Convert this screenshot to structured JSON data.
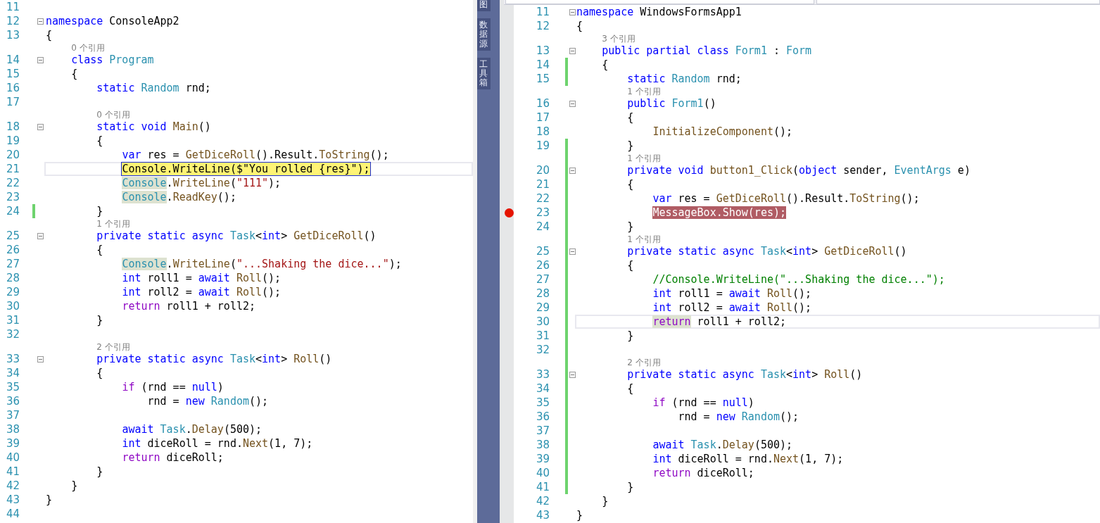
{
  "left_editor": {
    "lines": [
      {
        "number": "11"
      },
      {
        "number": "12",
        "fold": true,
        "tokens": [
          {
            "kind": "keyword",
            "text": "namespace"
          },
          {
            "kind": "plain",
            "text": " ConsoleApp2"
          }
        ]
      },
      {
        "number": "13",
        "tokens": [
          {
            "kind": "plain",
            "text": "{"
          }
        ]
      },
      {
        "lens": true,
        "text": "    0 个引用"
      },
      {
        "number": "14",
        "fold": true,
        "tokens": [
          {
            "kind": "keyword",
            "text": "    class "
          },
          {
            "kind": "type",
            "text": "Program"
          }
        ]
      },
      {
        "number": "15",
        "tokens": [
          {
            "kind": "plain",
            "text": "    {"
          }
        ]
      },
      {
        "number": "16",
        "tokens": [
          {
            "kind": "keyword",
            "text": "        static "
          },
          {
            "kind": "type",
            "text": "Random"
          },
          {
            "kind": "plain",
            "text": " rnd;"
          }
        ]
      },
      {
        "number": "17"
      },
      {
        "lens": true,
        "text": "        0 个引用"
      },
      {
        "number": "18",
        "fold": true,
        "tokens": [
          {
            "kind": "keyword",
            "text": "        static void "
          },
          {
            "kind": "method",
            "text": "Main"
          },
          {
            "kind": "plain",
            "text": "()"
          }
        ]
      },
      {
        "number": "19",
        "tokens": [
          {
            "kind": "plain",
            "text": "        {"
          }
        ]
      },
      {
        "number": "20",
        "tokens": [
          {
            "kind": "keyword",
            "text": "            var"
          },
          {
            "kind": "plain",
            "text": " res = "
          },
          {
            "kind": "method",
            "text": "GetDiceRoll"
          },
          {
            "kind": "plain",
            "text": "().Result."
          },
          {
            "kind": "method",
            "text": "ToString"
          },
          {
            "kind": "plain",
            "text": "();"
          }
        ]
      },
      {
        "number": "21",
        "caret": true,
        "current_statement": true,
        "tokens": [
          {
            "kind": "plain",
            "text": "            Console.WriteLine($\"You rolled {res}\");"
          }
        ]
      },
      {
        "number": "22",
        "tokens": [
          {
            "kind": "type",
            "text": "            Console",
            "highlighted": true
          },
          {
            "kind": "plain",
            "text": "."
          },
          {
            "kind": "method",
            "text": "WriteLine"
          },
          {
            "kind": "plain",
            "text": "("
          },
          {
            "kind": "string",
            "text": "\"111\""
          },
          {
            "kind": "plain",
            "text": ");"
          }
        ]
      },
      {
        "number": "23",
        "tokens": [
          {
            "kind": "type",
            "text": "            Console",
            "highlighted": true
          },
          {
            "kind": "plain",
            "text": "."
          },
          {
            "kind": "method",
            "text": "ReadKey"
          },
          {
            "kind": "plain",
            "text": "();"
          }
        ]
      },
      {
        "number": "24",
        "changed": true,
        "tokens": [
          {
            "kind": "plain",
            "text": "        }"
          }
        ]
      },
      {
        "lens": true,
        "text": "        1 个引用"
      },
      {
        "number": "25",
        "fold": true,
        "tokens": [
          {
            "kind": "keyword",
            "text": "        private static async "
          },
          {
            "kind": "type",
            "text": "Task"
          },
          {
            "kind": "plain",
            "text": "<"
          },
          {
            "kind": "keyword",
            "text": "int"
          },
          {
            "kind": "plain",
            "text": "> "
          },
          {
            "kind": "method",
            "text": "GetDiceRoll"
          },
          {
            "kind": "plain",
            "text": "()"
          }
        ]
      },
      {
        "number": "26",
        "tokens": [
          {
            "kind": "plain",
            "text": "        {"
          }
        ]
      },
      {
        "number": "27",
        "tokens": [
          {
            "kind": "type",
            "text": "            Console",
            "highlighted": true
          },
          {
            "kind": "plain",
            "text": "."
          },
          {
            "kind": "method",
            "text": "WriteLine"
          },
          {
            "kind": "plain",
            "text": "("
          },
          {
            "kind": "string",
            "text": "\"...Shaking the dice...\""
          },
          {
            "kind": "plain",
            "text": ");"
          }
        ]
      },
      {
        "number": "28",
        "tokens": [
          {
            "kind": "keyword",
            "text": "            int"
          },
          {
            "kind": "plain",
            "text": " roll1 = "
          },
          {
            "kind": "keyword",
            "text": "await "
          },
          {
            "kind": "method",
            "text": "Roll"
          },
          {
            "kind": "plain",
            "text": "();"
          }
        ]
      },
      {
        "number": "29",
        "tokens": [
          {
            "kind": "keyword",
            "text": "            int"
          },
          {
            "kind": "plain",
            "text": " roll2 = "
          },
          {
            "kind": "keyword",
            "text": "await "
          },
          {
            "kind": "method",
            "text": "Roll"
          },
          {
            "kind": "plain",
            "text": "();"
          }
        ]
      },
      {
        "number": "30",
        "tokens": [
          {
            "kind": "control",
            "text": "            return"
          },
          {
            "kind": "plain",
            "text": " roll1 + roll2;"
          }
        ]
      },
      {
        "number": "31",
        "tokens": [
          {
            "kind": "plain",
            "text": "        }"
          }
        ]
      },
      {
        "number": "32"
      },
      {
        "lens": true,
        "text": "        2 个引用"
      },
      {
        "number": "33",
        "fold": true,
        "tokens": [
          {
            "kind": "keyword",
            "text": "        private static async "
          },
          {
            "kind": "type",
            "text": "Task"
          },
          {
            "kind": "plain",
            "text": "<"
          },
          {
            "kind": "keyword",
            "text": "int"
          },
          {
            "kind": "plain",
            "text": "> "
          },
          {
            "kind": "method",
            "text": "Roll"
          },
          {
            "kind": "plain",
            "text": "()"
          }
        ]
      },
      {
        "number": "34",
        "tokens": [
          {
            "kind": "plain",
            "text": "        {"
          }
        ]
      },
      {
        "number": "35",
        "tokens": [
          {
            "kind": "control",
            "text": "            if"
          },
          {
            "kind": "plain",
            "text": " (rnd == "
          },
          {
            "kind": "keyword",
            "text": "null"
          },
          {
            "kind": "plain",
            "text": ")"
          }
        ]
      },
      {
        "number": "36",
        "tokens": [
          {
            "kind": "plain",
            "text": "                rnd = "
          },
          {
            "kind": "keyword",
            "text": "new "
          },
          {
            "kind": "type",
            "text": "Random"
          },
          {
            "kind": "plain",
            "text": "();"
          }
        ]
      },
      {
        "number": "37"
      },
      {
        "number": "38",
        "tokens": [
          {
            "kind": "keyword",
            "text": "            await "
          },
          {
            "kind": "type",
            "text": "Task"
          },
          {
            "kind": "plain",
            "text": "."
          },
          {
            "kind": "method",
            "text": "Delay"
          },
          {
            "kind": "plain",
            "text": "(500);"
          }
        ]
      },
      {
        "number": "39",
        "tokens": [
          {
            "kind": "keyword",
            "text": "            int"
          },
          {
            "kind": "plain",
            "text": " diceRoll = rnd."
          },
          {
            "kind": "method",
            "text": "Next"
          },
          {
            "kind": "plain",
            "text": "(1, 7);"
          }
        ]
      },
      {
        "number": "40",
        "tokens": [
          {
            "kind": "control",
            "text": "            return"
          },
          {
            "kind": "plain",
            "text": " diceRoll;"
          }
        ]
      },
      {
        "number": "41",
        "tokens": [
          {
            "kind": "plain",
            "text": "        }"
          }
        ]
      },
      {
        "number": "42",
        "tokens": [
          {
            "kind": "plain",
            "text": "    }"
          }
        ]
      },
      {
        "number": "43",
        "tokens": [
          {
            "kind": "plain",
            "text": "}"
          }
        ]
      },
      {
        "number": "44"
      }
    ]
  },
  "side_tabs": [
    {
      "label": "图"
    },
    {
      "label": "数据源"
    },
    {
      "label": "工具箱"
    }
  ],
  "right_editor": {
    "lines": [
      {
        "number": "11",
        "fold": true,
        "tokens": [
          {
            "kind": "keyword",
            "text": "namespace"
          },
          {
            "kind": "plain",
            "text": " WindowsFormsApp1"
          }
        ]
      },
      {
        "number": "12",
        "tokens": [
          {
            "kind": "plain",
            "text": "{"
          }
        ]
      },
      {
        "lens": true,
        "text": "    3 个引用"
      },
      {
        "number": "13",
        "fold": true,
        "tokens": [
          {
            "kind": "keyword",
            "text": "    public partial class "
          },
          {
            "kind": "type",
            "text": "Form1"
          },
          {
            "kind": "plain",
            "text": " : "
          },
          {
            "kind": "type",
            "text": "Form"
          }
        ]
      },
      {
        "number": "14",
        "changed": true,
        "tokens": [
          {
            "kind": "plain",
            "text": "    {"
          }
        ]
      },
      {
        "number": "15",
        "changed": true,
        "tokens": [
          {
            "kind": "keyword",
            "text": "        static "
          },
          {
            "kind": "type",
            "text": "Random"
          },
          {
            "kind": "plain",
            "text": " rnd;"
          }
        ]
      },
      {
        "lens": true,
        "text": "        1 个引用"
      },
      {
        "number": "16",
        "fold": true,
        "tokens": [
          {
            "kind": "keyword",
            "text": "        public "
          },
          {
            "kind": "type",
            "text": "Form1"
          },
          {
            "kind": "plain",
            "text": "()"
          }
        ]
      },
      {
        "number": "17",
        "tokens": [
          {
            "kind": "plain",
            "text": "        {"
          }
        ]
      },
      {
        "number": "18",
        "tokens": [
          {
            "kind": "method",
            "text": "            InitializeComponent"
          },
          {
            "kind": "plain",
            "text": "();"
          }
        ]
      },
      {
        "number": "19",
        "changed": true,
        "tokens": [
          {
            "kind": "plain",
            "text": "        }"
          }
        ]
      },
      {
        "lens": true,
        "changed": true,
        "text": "        1 个引用"
      },
      {
        "number": "20",
        "fold": true,
        "changed": true,
        "tokens": [
          {
            "kind": "keyword",
            "text": "        private void "
          },
          {
            "kind": "method",
            "text": "button1_Click"
          },
          {
            "kind": "plain",
            "text": "("
          },
          {
            "kind": "keyword",
            "text": "object"
          },
          {
            "kind": "plain",
            "text": " sender, "
          },
          {
            "kind": "type",
            "text": "EventArgs"
          },
          {
            "kind": "plain",
            "text": " e)"
          }
        ]
      },
      {
        "number": "21",
        "changed": true,
        "tokens": [
          {
            "kind": "plain",
            "text": "        {"
          }
        ]
      },
      {
        "number": "22",
        "changed": true,
        "tokens": [
          {
            "kind": "keyword",
            "text": "            var"
          },
          {
            "kind": "plain",
            "text": " res = "
          },
          {
            "kind": "method",
            "text": "GetDiceRoll"
          },
          {
            "kind": "plain",
            "text": "().Result."
          },
          {
            "kind": "method",
            "text": "ToString"
          },
          {
            "kind": "plain",
            "text": "();"
          }
        ]
      },
      {
        "number": "23",
        "changed": true,
        "breakpoint": true,
        "tokens": [
          {
            "kind": "plain",
            "text": "            MessageBox.Show(res);"
          }
        ]
      },
      {
        "number": "24",
        "changed": true,
        "tokens": [
          {
            "kind": "plain",
            "text": "        }"
          }
        ]
      },
      {
        "lens": true,
        "changed": true,
        "text": "        1 个引用"
      },
      {
        "number": "25",
        "fold": true,
        "changed": true,
        "tokens": [
          {
            "kind": "keyword",
            "text": "        private static async "
          },
          {
            "kind": "type",
            "text": "Task"
          },
          {
            "kind": "plain",
            "text": "<"
          },
          {
            "kind": "keyword",
            "text": "int"
          },
          {
            "kind": "plain",
            "text": "> "
          },
          {
            "kind": "method",
            "text": "GetDiceRoll"
          },
          {
            "kind": "plain",
            "text": "()"
          }
        ]
      },
      {
        "number": "26",
        "changed": true,
        "tokens": [
          {
            "kind": "plain",
            "text": "        {"
          }
        ]
      },
      {
        "number": "27",
        "changed": true,
        "tokens": [
          {
            "kind": "comment",
            "text": "            //Console.WriteLine(\"...Shaking the dice...\");"
          }
        ]
      },
      {
        "number": "28",
        "changed": true,
        "tokens": [
          {
            "kind": "keyword",
            "text": "            int"
          },
          {
            "kind": "plain",
            "text": " roll1 = "
          },
          {
            "kind": "keyword",
            "text": "await "
          },
          {
            "kind": "method",
            "text": "Roll"
          },
          {
            "kind": "plain",
            "text": "();"
          }
        ]
      },
      {
        "number": "29",
        "changed": true,
        "tokens": [
          {
            "kind": "keyword",
            "text": "            int"
          },
          {
            "kind": "plain",
            "text": " roll2 = "
          },
          {
            "kind": "keyword",
            "text": "await "
          },
          {
            "kind": "method",
            "text": "Roll"
          },
          {
            "kind": "plain",
            "text": "();"
          }
        ]
      },
      {
        "number": "30",
        "changed": true,
        "caret": true,
        "tokens": [
          {
            "kind": "control",
            "text": "            return",
            "highlighted": true
          },
          {
            "kind": "plain",
            "text": " roll1 + roll2;"
          }
        ]
      },
      {
        "number": "31",
        "changed": true,
        "tokens": [
          {
            "kind": "plain",
            "text": "        }"
          }
        ]
      },
      {
        "number": "32",
        "changed": true
      },
      {
        "lens": true,
        "changed": true,
        "text": "        2 个引用"
      },
      {
        "number": "33",
        "fold": true,
        "changed": true,
        "tokens": [
          {
            "kind": "keyword",
            "text": "        private static async "
          },
          {
            "kind": "type",
            "text": "Task"
          },
          {
            "kind": "plain",
            "text": "<"
          },
          {
            "kind": "keyword",
            "text": "int"
          },
          {
            "kind": "plain",
            "text": "> "
          },
          {
            "kind": "method",
            "text": "Roll"
          },
          {
            "kind": "plain",
            "text": "()"
          }
        ]
      },
      {
        "number": "34",
        "changed": true,
        "tokens": [
          {
            "kind": "plain",
            "text": "        {"
          }
        ]
      },
      {
        "number": "35",
        "changed": true,
        "tokens": [
          {
            "kind": "control",
            "text": "            if"
          },
          {
            "kind": "plain",
            "text": " (rnd == "
          },
          {
            "kind": "keyword",
            "text": "null"
          },
          {
            "kind": "plain",
            "text": ")"
          }
        ]
      },
      {
        "number": "36",
        "changed": true,
        "tokens": [
          {
            "kind": "plain",
            "text": "                rnd = "
          },
          {
            "kind": "keyword",
            "text": "new "
          },
          {
            "kind": "type",
            "text": "Random"
          },
          {
            "kind": "plain",
            "text": "();"
          }
        ]
      },
      {
        "number": "37",
        "changed": true
      },
      {
        "number": "38",
        "changed": true,
        "tokens": [
          {
            "kind": "keyword",
            "text": "            await "
          },
          {
            "kind": "type",
            "text": "Task"
          },
          {
            "kind": "plain",
            "text": "."
          },
          {
            "kind": "method",
            "text": "Delay"
          },
          {
            "kind": "plain",
            "text": "(500);"
          }
        ]
      },
      {
        "number": "39",
        "changed": true,
        "tokens": [
          {
            "kind": "keyword",
            "text": "            int"
          },
          {
            "kind": "plain",
            "text": " diceRoll = rnd."
          },
          {
            "kind": "method",
            "text": "Next"
          },
          {
            "kind": "plain",
            "text": "(1, 7);"
          }
        ]
      },
      {
        "number": "40",
        "changed": true,
        "tokens": [
          {
            "kind": "control",
            "text": "            return"
          },
          {
            "kind": "plain",
            "text": " diceRoll;"
          }
        ]
      },
      {
        "number": "41",
        "changed": true,
        "tokens": [
          {
            "kind": "plain",
            "text": "        }"
          }
        ]
      },
      {
        "number": "42",
        "tokens": [
          {
            "kind": "plain",
            "text": "    }"
          }
        ]
      },
      {
        "number": "43",
        "tokens": [
          {
            "kind": "plain",
            "text": "}"
          }
        ]
      }
    ]
  }
}
